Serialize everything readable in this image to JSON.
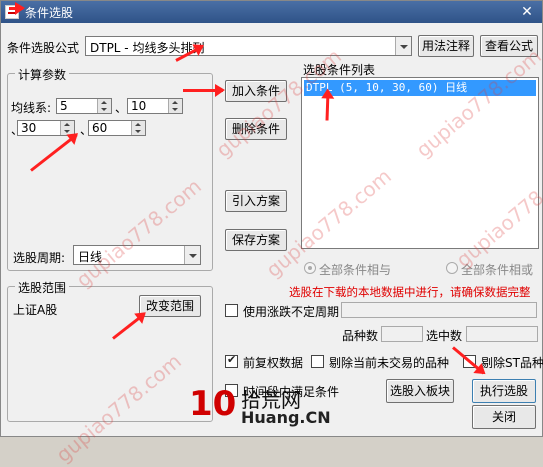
{
  "window": {
    "title": "条件选股"
  },
  "formula": {
    "label": "条件选股公式",
    "value": "DTPL   - 均线多头排列"
  },
  "buttons": {
    "usage": "用法注释",
    "view_formula": "查看公式",
    "add_condition": "加入条件",
    "delete_condition": "删除条件",
    "import_plan": "引入方案",
    "save_plan": "保存方案",
    "change_range": "改变范围",
    "select_to_block": "选股入板块",
    "execute": "执行选股",
    "close": "关闭"
  },
  "params": {
    "group_title": "计算参数",
    "ma_label": "均线系:",
    "separator": "、",
    "p1": "5",
    "p2": "10",
    "p3": "30",
    "p4": "60",
    "period_label": "选股周期:",
    "period_value": "日线"
  },
  "conditions": {
    "title": "选股条件列表",
    "items": [
      "DTPL (5, 10, 30, 60) 日线"
    ]
  },
  "logic": {
    "all_and": "全部条件相与",
    "all_or": "全部条件相或"
  },
  "range": {
    "group_title": "选股范围",
    "value": "上证A股"
  },
  "notice": "选股在下载的本地数据中进行，请确保数据完整",
  "options": {
    "limit_unfixed": "使用涨跌不定周期",
    "count_label": "品种数",
    "selected_label": "选中数",
    "fq_data": "前复权数据",
    "exclude_untrading": "剔除当前未交易的品种",
    "exclude_st": "剔除ST品种",
    "time_label": "时间段内满足条件"
  },
  "watermark": {
    "text": "gupiao778.com",
    "logo_num": "10",
    "logo_cn": "拾荒网",
    "logo_dom": "Huang.CN"
  },
  "icons": [
    "app-icon",
    "close-icon",
    "chevron-down-icon",
    "spin-up-icon",
    "spin-down-icon",
    "annotation-arrow"
  ]
}
